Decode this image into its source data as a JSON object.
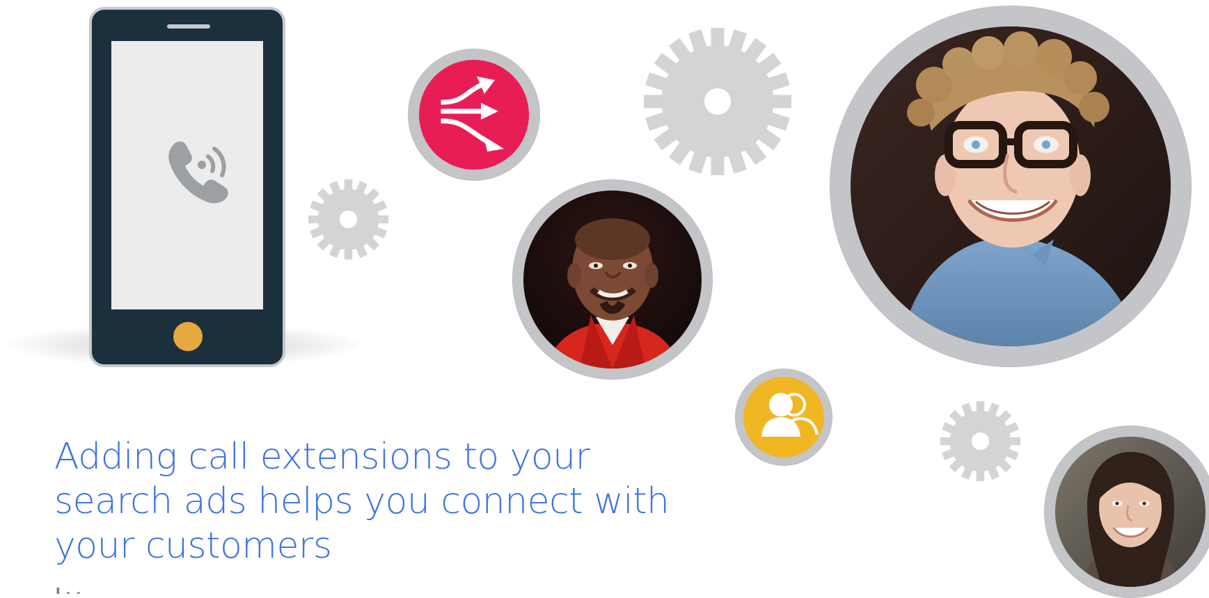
{
  "headline": {
    "line1": "Adding call extensions to your",
    "line2": "search ads helps you connect with",
    "line3": "your customers"
  },
  "subtext": {
    "cutoff": "Ly..."
  },
  "illustration": {
    "phone_icon": "phone-call-icon",
    "arrow_icon": "arrows-split-icon",
    "people_icon": "users-icon",
    "gear_icon": "gear-icon",
    "portraits": [
      "man-red-shirt-portrait",
      "young-man-glasses-portrait",
      "woman-smiling-portrait"
    ],
    "colors": {
      "headline": "#3f73df",
      "phone_body": "#1c2f3d",
      "phone_home": "#e6a93f",
      "arrow_badge": "#e91d55",
      "people_badge": "#f0b624",
      "gear": "#d3d4d6",
      "ring": "#c3c5c8"
    }
  }
}
